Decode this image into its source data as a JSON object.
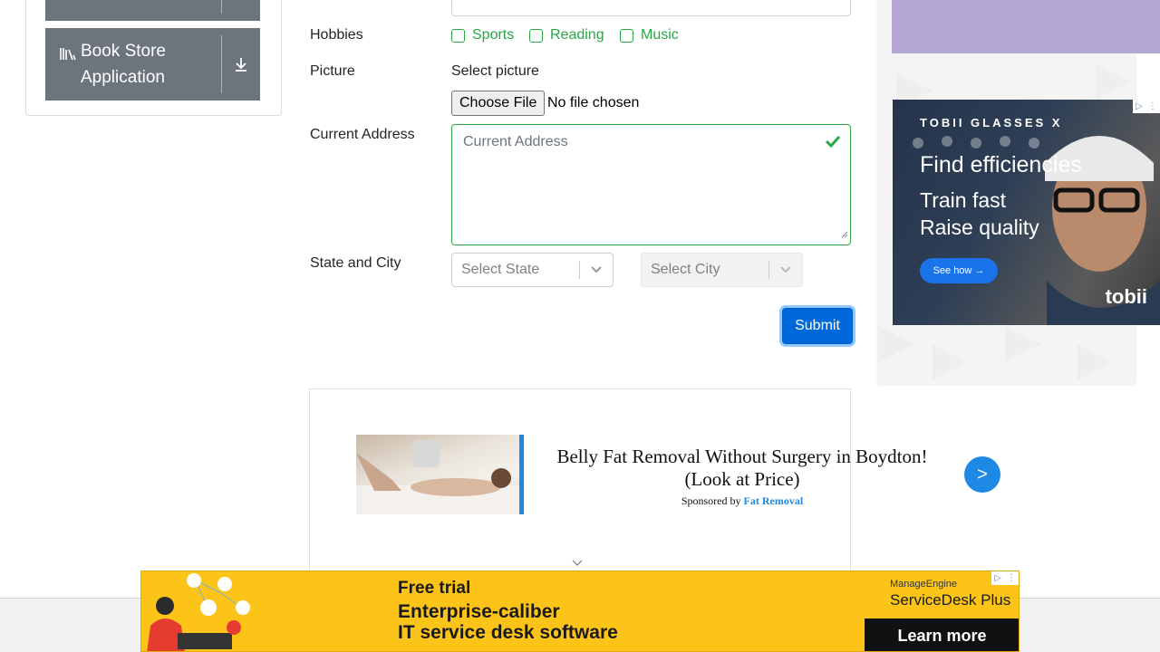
{
  "sidebar": {
    "item_book_store": {
      "label": "Book Store Application"
    }
  },
  "form": {
    "hobbies": {
      "label": "Hobbies",
      "options": [
        "Sports",
        "Reading",
        "Music"
      ]
    },
    "picture": {
      "label": "Picture",
      "heading": "Select picture",
      "button": "Choose File",
      "status": "No file chosen"
    },
    "address": {
      "label": "Current Address",
      "placeholder": "Current Address"
    },
    "state_city": {
      "label": "State and City",
      "state_placeholder": "Select State",
      "city_placeholder": "Select City"
    },
    "submit": "Submit"
  },
  "ads": {
    "tobii": {
      "brand": "TOBII GLASSES X",
      "headline": "Find efficiencies",
      "line2": "Train fast",
      "line3": "Raise quality",
      "cta": "See how →",
      "logo": "tobii"
    },
    "fat_removal": {
      "title": "Belly Fat Removal Without Surgery in Boydton! (Look at Price)",
      "sponsored_prefix": "Sponsored by",
      "sponsor": "Fat Removal",
      "go": ">"
    },
    "manageengine": {
      "tagline": "Free trial",
      "headline_1": "Enterprise-caliber",
      "headline_2": "IT service desk software",
      "brand": "ManageEngine",
      "product": "ServiceDesk Plus",
      "cta": "Learn more"
    }
  },
  "colors": {
    "success": "#28a745",
    "primary": "#0069d9",
    "sidebar_button": "#6c757d",
    "ad_yellow": "#fcc419",
    "ad_purple": "#b4a7d6"
  }
}
